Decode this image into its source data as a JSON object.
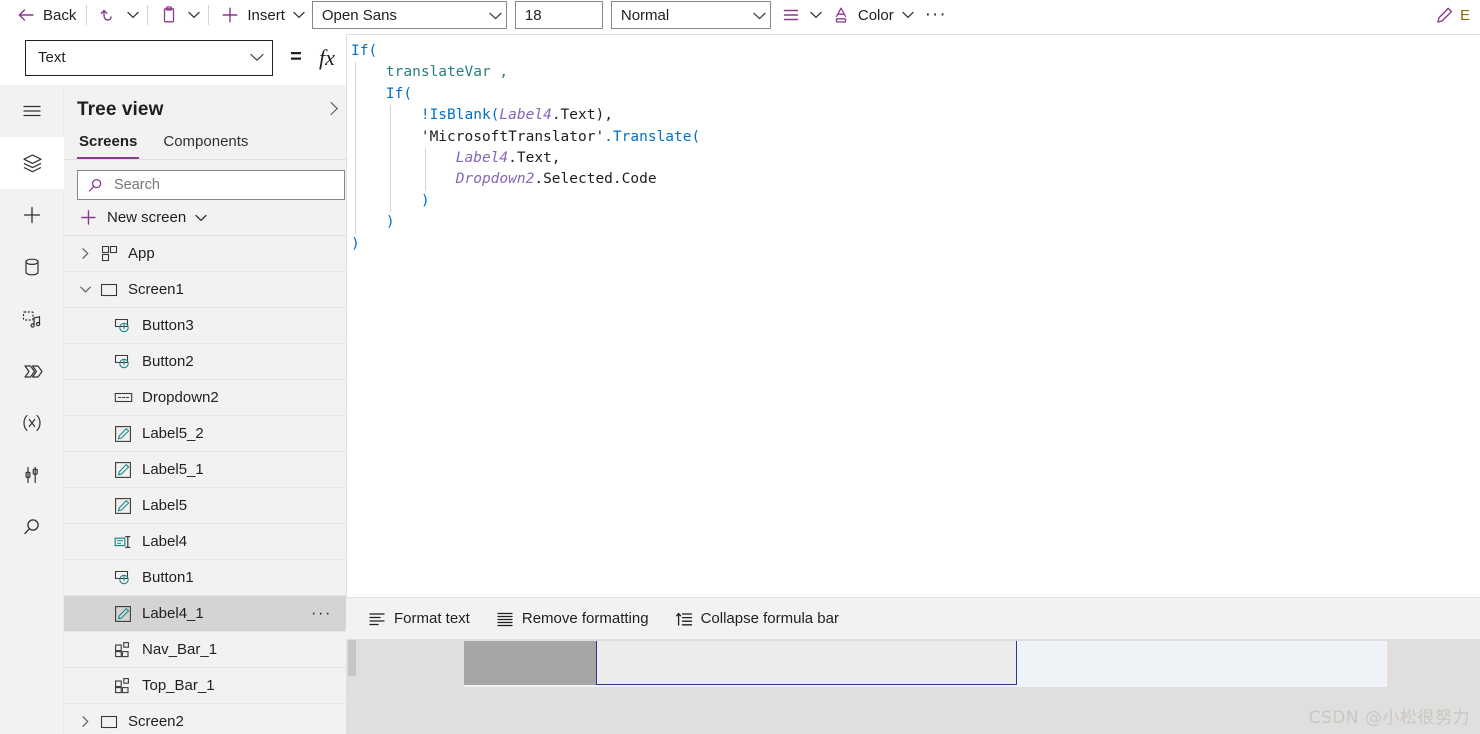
{
  "commandbar": {
    "back_label": "Back",
    "undo_icon": "undo-icon",
    "paste_icon": "paste-icon",
    "insert_label": "Insert",
    "font_family_value": "Open Sans",
    "font_size_value": "18",
    "font_weight_value": "Normal",
    "align_icon": "align-icon",
    "color_label": "Color",
    "overflow_label": "···",
    "edit_icon": "pencil-icon",
    "edit_label_partial": "E"
  },
  "formula_bar": {
    "property_value": "Text",
    "equals_sign": "=",
    "fx_sign": "fx",
    "code_lines": [
      [
        {
          "t": "If(",
          "c": "k-fn"
        }
      ],
      [
        {
          "t": "    ",
          "c": "k-plain"
        },
        {
          "t": "translateVar ,",
          "c": "k-var"
        }
      ],
      [
        {
          "t": "    ",
          "c": "k-plain"
        },
        {
          "t": "If(",
          "c": "k-fn"
        }
      ],
      [
        {
          "t": "        ",
          "c": "k-plain"
        },
        {
          "t": "!IsBlank(",
          "c": "k-fn"
        },
        {
          "t": "Label4",
          "c": "k-ctrl"
        },
        {
          "t": ".Text),",
          "c": "k-plain"
        }
      ],
      [
        {
          "t": "        ",
          "c": "k-plain"
        },
        {
          "t": "'MicrosoftTranslator'",
          "c": "k-plain"
        },
        {
          "t": ".Translate(",
          "c": "k-meth"
        }
      ],
      [
        {
          "t": "            ",
          "c": "k-plain"
        },
        {
          "t": "Label4",
          "c": "k-ctrl"
        },
        {
          "t": ".Text,",
          "c": "k-plain"
        }
      ],
      [
        {
          "t": "            ",
          "c": "k-plain"
        },
        {
          "t": "Dropdown2",
          "c": "k-ctrl"
        },
        {
          "t": ".Selected.Code",
          "c": "k-plain"
        }
      ],
      [
        {
          "t": "        ",
          "c": "k-plain"
        },
        {
          "t": ")",
          "c": "k-paren"
        }
      ],
      [
        {
          "t": "    ",
          "c": "k-plain"
        },
        {
          "t": ")",
          "c": "k-paren"
        }
      ],
      [
        {
          "t": ")",
          "c": "k-paren"
        }
      ]
    ],
    "plain_text": "If(\n    translateVar ,\n    If(\n        !IsBlank(Label4.Text),\n        'MicrosoftTranslator'.Translate(\n            Label4.Text,\n            Dropdown2.Selected.Code\n        )\n    )\n)",
    "footer": {
      "format_text": "Format text",
      "remove_formatting": "Remove formatting",
      "collapse_formula_bar": "Collapse formula bar"
    }
  },
  "rail": {
    "items": [
      {
        "icon": "hamburger-icon",
        "name": "menu",
        "active": false
      },
      {
        "icon": "layers-icon",
        "name": "tree-view",
        "active": true
      },
      {
        "icon": "plus-icon",
        "name": "insert",
        "active": false
      },
      {
        "icon": "database-icon",
        "name": "data",
        "active": false
      },
      {
        "icon": "media-icon",
        "name": "media",
        "active": false
      },
      {
        "icon": "power-automate-icon",
        "name": "power-automate",
        "active": false
      },
      {
        "icon": "variables-icon",
        "name": "variables",
        "active": false
      },
      {
        "icon": "tools-icon",
        "name": "advanced-tools",
        "active": false
      },
      {
        "icon": "search-icon",
        "name": "search",
        "active": false
      }
    ]
  },
  "tree_view": {
    "title": "Tree view",
    "collapse_icon": "chevron-right-icon",
    "tabs": [
      {
        "label": "Screens",
        "selected": true
      },
      {
        "label": "Components",
        "selected": false
      }
    ],
    "search": {
      "placeholder": "Search",
      "value": "",
      "icon": "search-icon"
    },
    "new_screen": {
      "label": "New screen",
      "plus_icon": "plus-icon",
      "chevron_icon": "chevron-down-icon"
    },
    "nodes": [
      {
        "label": "App",
        "icon": "app-icon",
        "indent": 0,
        "twist": "right",
        "selected": false,
        "dots": false
      },
      {
        "label": "Screen1",
        "icon": "screen-icon",
        "indent": 0,
        "twist": "down",
        "selected": false,
        "dots": false
      },
      {
        "label": "Button3",
        "icon": "button-icon",
        "indent": 2,
        "twist": "",
        "selected": false,
        "dots": false
      },
      {
        "label": "Button2",
        "icon": "button-icon",
        "indent": 2,
        "twist": "",
        "selected": false,
        "dots": false
      },
      {
        "label": "Dropdown2",
        "icon": "dropdown-icon",
        "indent": 2,
        "twist": "",
        "selected": false,
        "dots": false
      },
      {
        "label": "Label5_2",
        "icon": "label-icon",
        "indent": 2,
        "twist": "",
        "selected": false,
        "dots": false
      },
      {
        "label": "Label5_1",
        "icon": "label-icon",
        "indent": 2,
        "twist": "",
        "selected": false,
        "dots": false
      },
      {
        "label": "Label5",
        "icon": "label-icon",
        "indent": 2,
        "twist": "",
        "selected": false,
        "dots": false
      },
      {
        "label": "Label4",
        "icon": "textinput-icon",
        "indent": 2,
        "twist": "",
        "selected": false,
        "dots": false
      },
      {
        "label": "Button1",
        "icon": "button-icon",
        "indent": 2,
        "twist": "",
        "selected": false,
        "dots": false
      },
      {
        "label": "Label4_1",
        "icon": "label-icon",
        "indent": 2,
        "twist": "",
        "selected": true,
        "dots": true
      },
      {
        "label": "Nav_Bar_1",
        "icon": "component-icon",
        "indent": 2,
        "twist": "",
        "selected": false,
        "dots": false
      },
      {
        "label": "Top_Bar_1",
        "icon": "component-icon",
        "indent": 2,
        "twist": "",
        "selected": false,
        "dots": false
      },
      {
        "label": "Screen2",
        "icon": "screen-icon",
        "indent": 0,
        "twist": "right",
        "selected": false,
        "dots": false
      }
    ]
  },
  "canvas": {
    "watermark": "CSDN @小松很努力"
  },
  "colors": {
    "accent": "#8a3a8f",
    "selection_border": "#2b3a8f",
    "tree_selected_bg": "#d6d4d2",
    "code_function": "#0070c9",
    "code_variable": "#267f7f",
    "code_control": "#8764b8",
    "canvas_bg": "#e1dfdd",
    "screen_bg": "#eff3f8",
    "nav_block": "#a6a6a6"
  }
}
